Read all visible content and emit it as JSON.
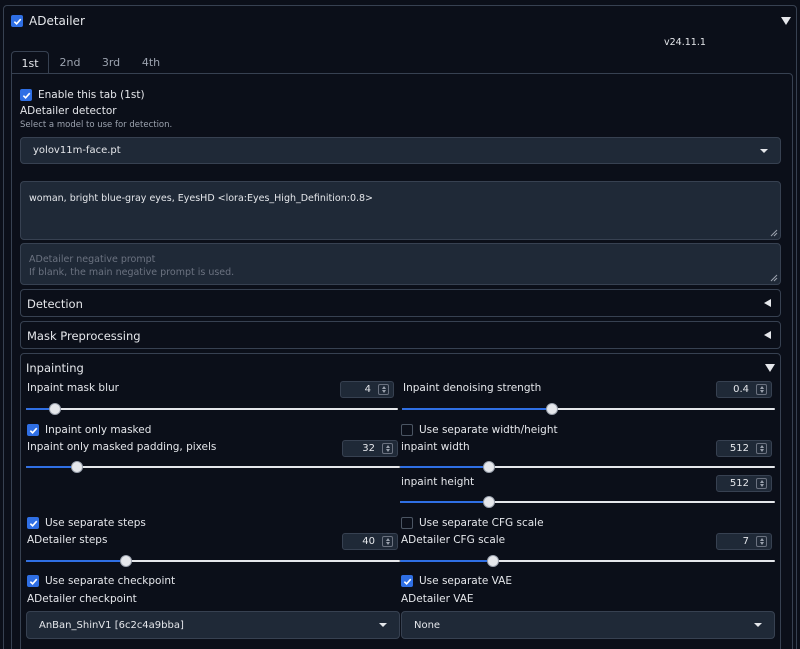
{
  "header": {
    "title": "ADetailer",
    "enabled": true,
    "version": "v24.11.1"
  },
  "tabs": [
    {
      "label": "1st",
      "active": true
    },
    {
      "label": "2nd",
      "active": false
    },
    {
      "label": "3rd",
      "active": false
    },
    {
      "label": "4th",
      "active": false
    }
  ],
  "enable_tab": {
    "label": "Enable this tab (1st)",
    "checked": true
  },
  "detector": {
    "label": "ADetailer detector",
    "hint": "Select a model to use for detection.",
    "value": "yolov11m-face.pt"
  },
  "prompt": {
    "value": "woman, bright blue-gray eyes, EyesHD <lora:Eyes_High_Definition:0.8>"
  },
  "negative_prompt": {
    "placeholder_line1": "ADetailer negative prompt",
    "placeholder_line2": "If blank, the main negative prompt is used."
  },
  "accordions": {
    "detection": "Detection",
    "mask_preprocessing": "Mask Preprocessing",
    "inpainting": "Inpainting"
  },
  "inpainting": {
    "mask_blur": {
      "label": "Inpaint mask blur",
      "value": "4",
      "fraction": 0.064
    },
    "denoise": {
      "label": "Inpaint denoising strength",
      "value": "0.4",
      "fraction": 0.4
    },
    "only_masked": {
      "label": "Inpaint only masked",
      "checked": true
    },
    "separate_wh": {
      "label": "Use separate width/height",
      "checked": false
    },
    "padding": {
      "label": "Inpaint only masked padding, pixels",
      "value": "32",
      "fraction": 0.125
    },
    "width": {
      "label": "inpaint width",
      "value": "512",
      "fraction": 0.23
    },
    "height": {
      "label": "inpaint height",
      "value": "512",
      "fraction": 0.23
    },
    "separate_steps": {
      "label": "Use separate steps",
      "checked": true
    },
    "separate_cfg": {
      "label": "Use separate CFG scale",
      "checked": false
    },
    "steps": {
      "label": "ADetailer steps",
      "value": "40",
      "fraction": 0.26
    },
    "cfg": {
      "label": "ADetailer CFG scale",
      "value": "7",
      "fraction": 0.24
    },
    "separate_checkpoint": {
      "label": "Use separate checkpoint",
      "checked": true
    },
    "separate_vae": {
      "label": "Use separate VAE",
      "checked": true
    },
    "checkpoint": {
      "label": "ADetailer checkpoint",
      "value": "AnBan_ShinV1 [6c2c4a9bba]"
    },
    "vae": {
      "label": "ADetailer VAE",
      "value": "None"
    }
  },
  "colors": {
    "accent": "#2f6fe4",
    "background": "#0b0f19",
    "field": "#1f2937",
    "border": "#374151"
  }
}
